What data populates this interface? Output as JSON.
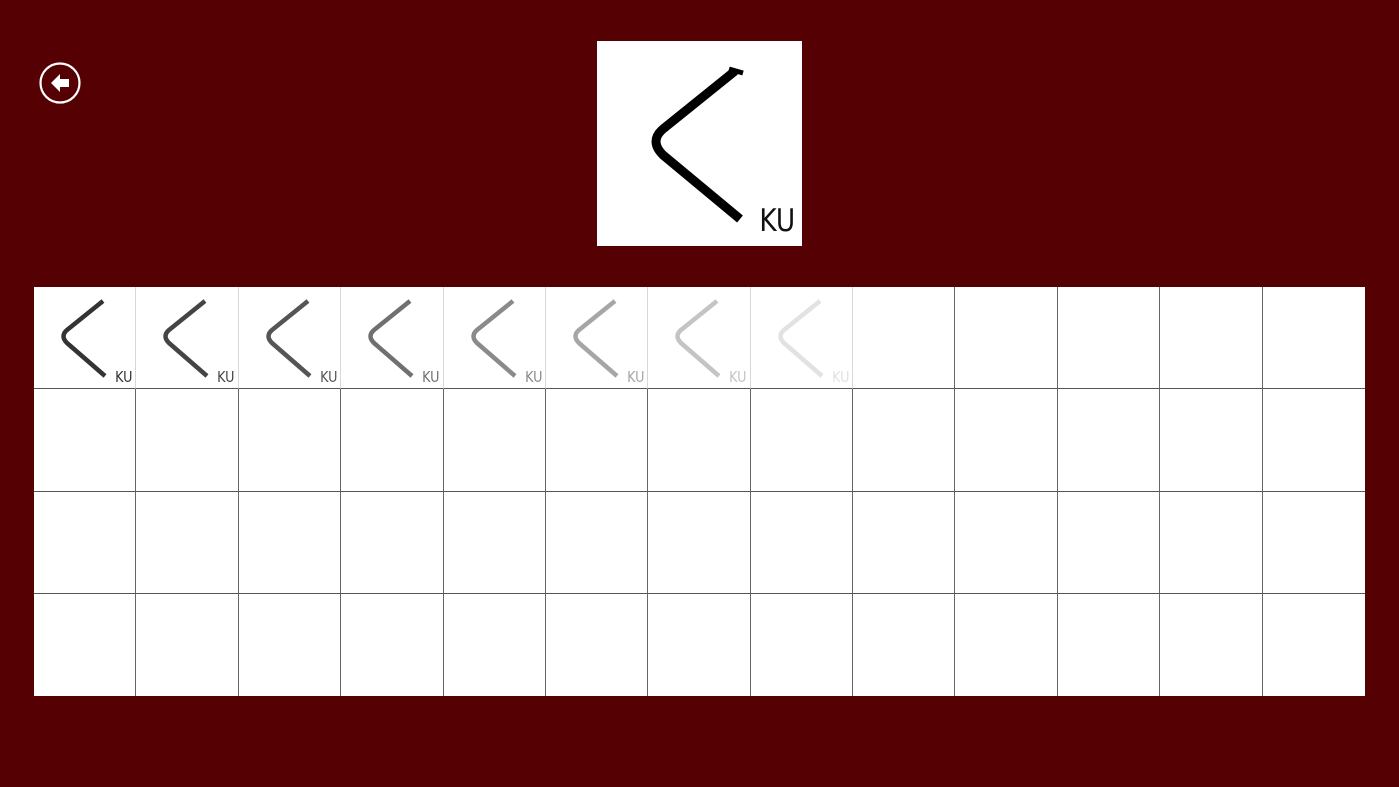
{
  "back_button": {
    "icon": "back-arrow-icon"
  },
  "hero": {
    "kana": "く",
    "romaji": "KU",
    "stroke_color": "#000000"
  },
  "practice": {
    "rows": 4,
    "cols": 13,
    "guide_romaji": "KU",
    "guide_colors": [
      "#333333",
      "#444444",
      "#555555",
      "#707070",
      "#8a8a8a",
      "#a6a6a6",
      "#c4c4c4",
      "#e2e2e2"
    ]
  },
  "colors": {
    "background": "#550003",
    "card": "#ffffff",
    "grid_line": "#555555"
  }
}
